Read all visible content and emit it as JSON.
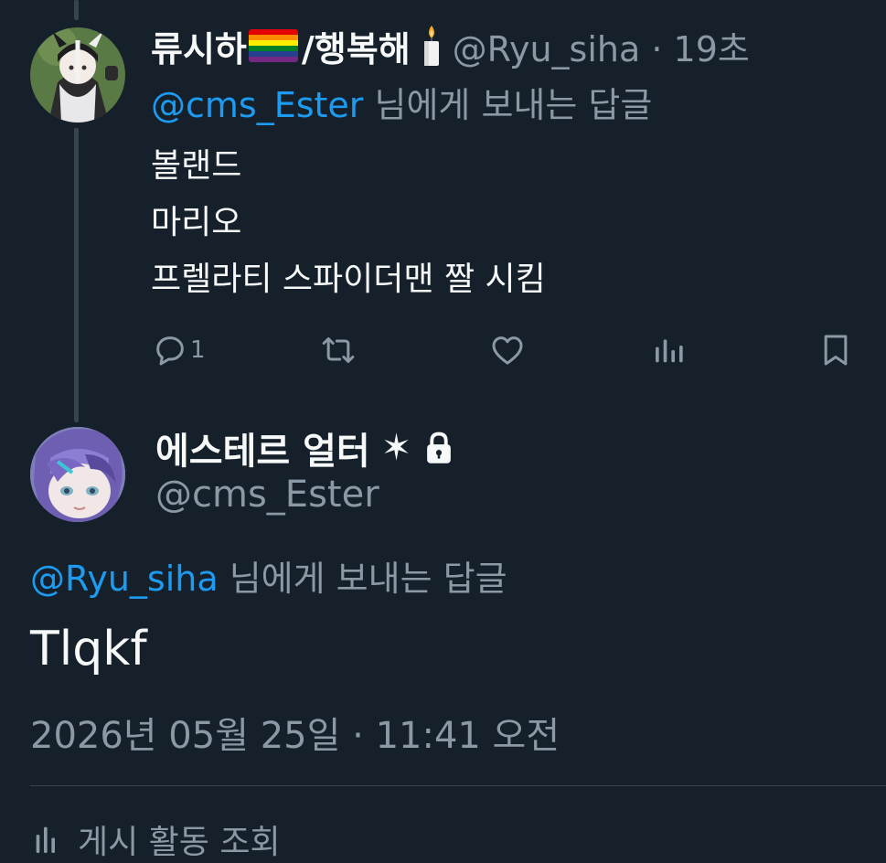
{
  "reply_tweet": {
    "display_name": "류시하",
    "display_name_suffix": "/행복해",
    "name_emojis": [
      "rainbow-flag-icon",
      "candle-icon"
    ],
    "handle_time": "@Ryu_siha · 19초",
    "replying_to": {
      "mention": "@cms_Ester",
      "suffix": " 님에게 보내는 답글"
    },
    "body_lines": [
      "볼랜드",
      "마리오",
      "프렐라티 스파이더맨 짤 시킴"
    ],
    "actions": {
      "reply_count": "1",
      "icons": [
        "reply-icon",
        "retweet-icon",
        "like-icon",
        "views-icon",
        "bookmark-icon"
      ]
    }
  },
  "main_tweet": {
    "display_name": "에스테르 얼터",
    "star_glyph": "✶",
    "locked_icon": "lock-icon",
    "handle": "@cms_Ester",
    "replying_to": {
      "mention": "@Ryu_siha",
      "suffix": " 님에게 보내는 답글"
    },
    "text": "Tlqkf",
    "timestamp": "2026년 05월 25일 · 11:41 오전",
    "activity_label": "게시 활동 조회"
  },
  "colors": {
    "background": "#15202b",
    "text_primary": "#f7f9f9",
    "text_secondary": "#8b98a5",
    "accent": "#1d9bf0",
    "border": "#38444d"
  }
}
